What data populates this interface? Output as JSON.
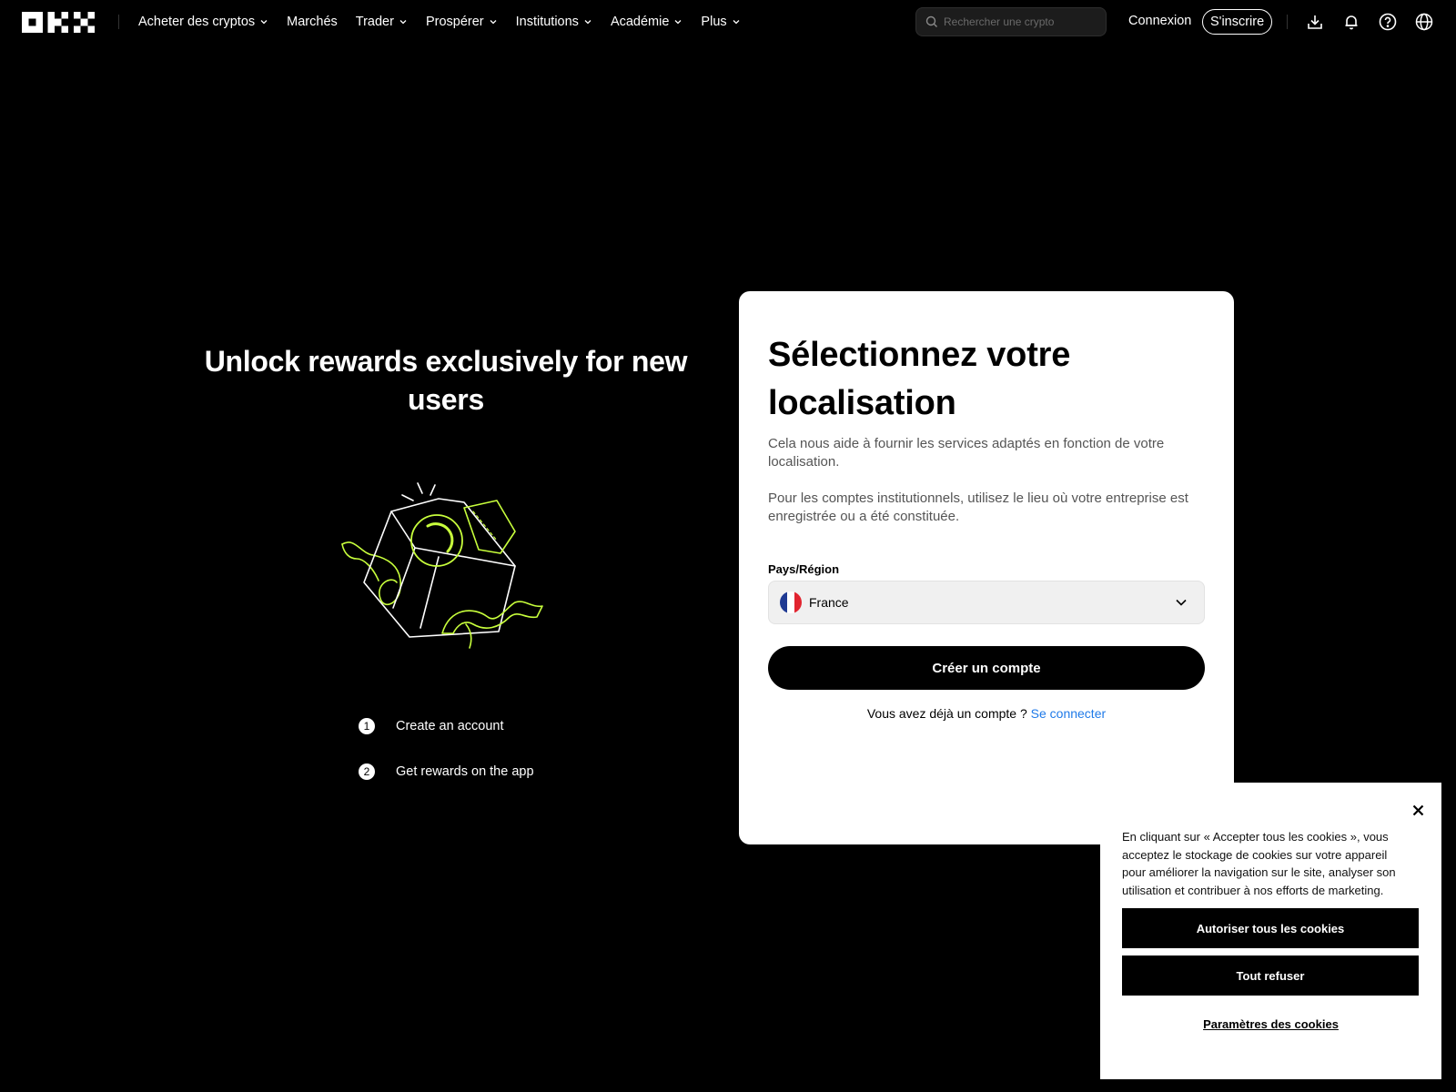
{
  "nav": {
    "logo_alt": "OKX",
    "items": [
      {
        "label": "Acheter des cryptos",
        "dropdown": true
      },
      {
        "label": "Marchés",
        "dropdown": false
      },
      {
        "label": "Trader",
        "dropdown": true
      },
      {
        "label": "Prospérer",
        "dropdown": true
      },
      {
        "label": "Institutions",
        "dropdown": true
      },
      {
        "label": "Académie",
        "dropdown": true
      },
      {
        "label": "Plus",
        "dropdown": true
      }
    ],
    "search_placeholder": "Rechercher une crypto",
    "login": "Connexion",
    "signup": "S'inscrire",
    "icons": [
      "download-icon",
      "bell-icon",
      "help-icon",
      "globe-icon"
    ]
  },
  "promo": {
    "title": "Unlock rewards exclusively for new users",
    "accent_color": "#c8ff3c",
    "steps": [
      {
        "num": "1",
        "label": "Create an account"
      },
      {
        "num": "2",
        "label": "Get rewards on the app"
      }
    ]
  },
  "card": {
    "title": "Sélectionnez votre localisation",
    "desc1": "Cela nous aide à fournir les services adaptés en fonction de votre localisation.",
    "desc2": "Pour les comptes institutionnels, utilisez le lieu où votre entreprise est enregistrée ou a été constituée.",
    "field_label": "Pays/Région",
    "selected_country": "France",
    "primary_button": "Créer un compte",
    "have_account": "Vous avez déjà un compte ?",
    "login_link": "Se connecter",
    "link_color": "#1f7ae8"
  },
  "cookie": {
    "text": "En cliquant sur « Accepter tous les cookies », vous acceptez le stockage de cookies sur votre appareil pour améliorer la navigation sur le site, analyser son utilisation et contribuer à nos efforts de marketing.",
    "accept": "Autoriser tous les cookies",
    "reject": "Tout refuser",
    "settings": "Paramètres des cookies"
  }
}
